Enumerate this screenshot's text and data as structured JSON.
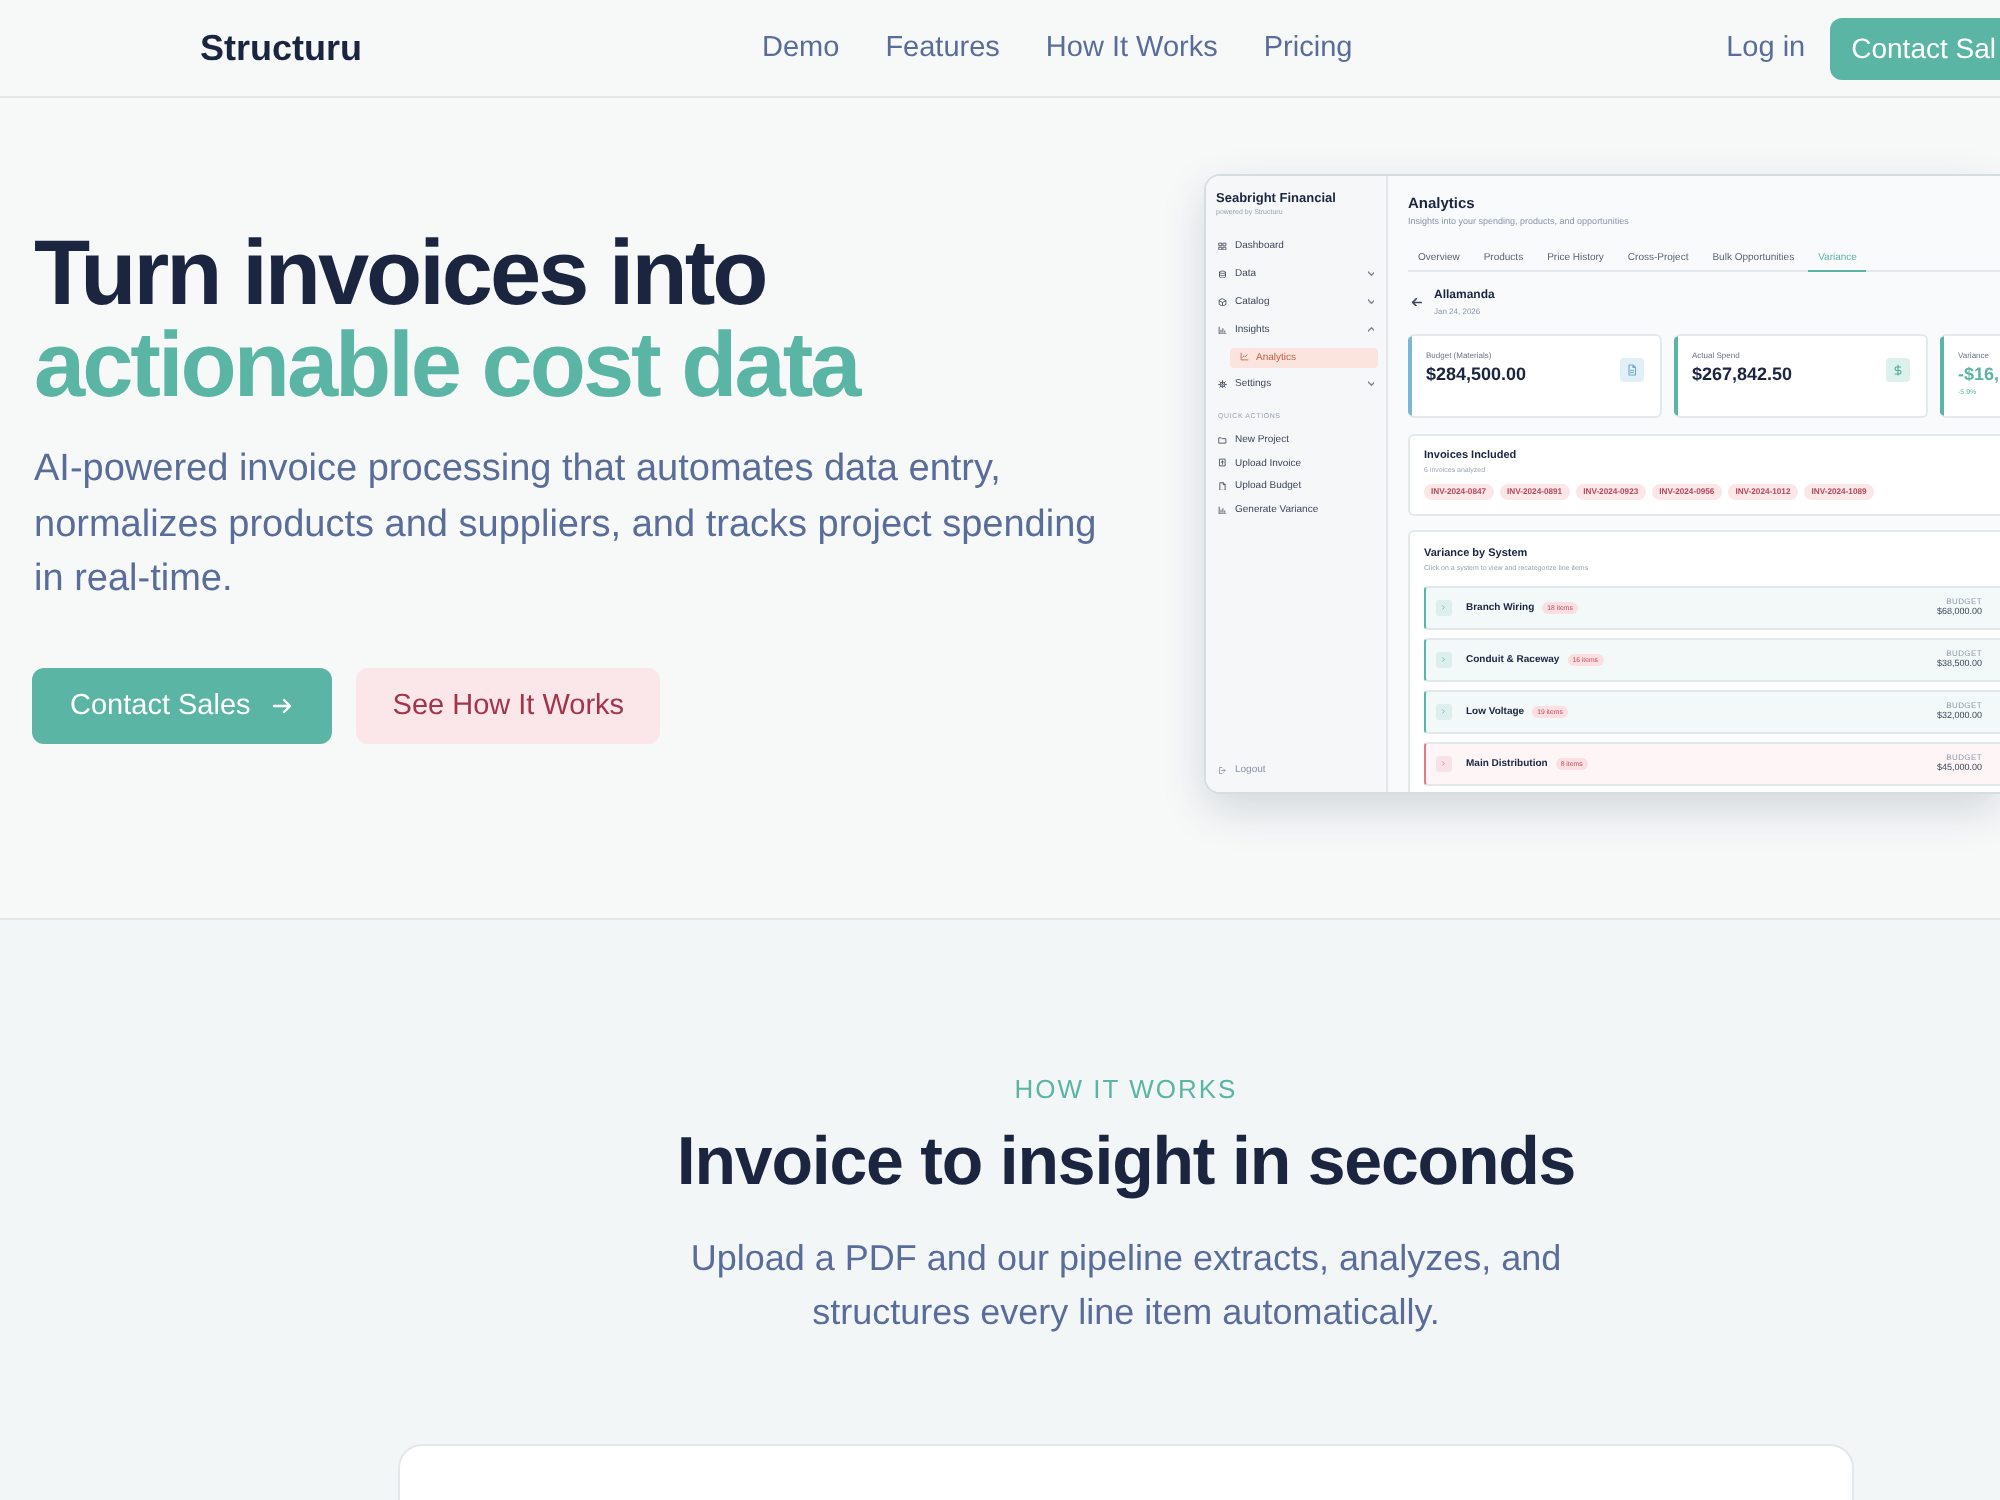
{
  "nav": {
    "logo": "Structuru",
    "links": [
      {
        "label": "Demo"
      },
      {
        "label": "Features"
      },
      {
        "label": "How It Works"
      },
      {
        "label": "Pricing"
      }
    ],
    "login": "Log in",
    "cta": "Contact Sal"
  },
  "hero": {
    "title": [
      {
        "text": "Turn invoices into",
        "kind": "plain"
      },
      {
        "text": "actionable cost data",
        "kind": "accent"
      }
    ],
    "description": "AI-powered invoice processing that automates data entry, normalizes products and suppliers, and tracks project spending in real-time.",
    "buttons": [
      {
        "label": "Contact Sales",
        "kind": "primary"
      },
      {
        "label": "See How It Works",
        "kind": "secondary"
      }
    ]
  },
  "app_preview": {
    "sidebar": {
      "org": "Seabright Financial",
      "tagline": "powered by Structuru",
      "items": [
        {
          "label": "Dashboard",
          "kind": "link",
          "selected": false
        },
        {
          "label": "Data",
          "kind": "group",
          "expanded": false,
          "selected": false
        },
        {
          "label": "Catalog",
          "kind": "group",
          "expanded": false,
          "selected": false
        },
        {
          "label": "Insights",
          "kind": "group",
          "expanded": true,
          "selected": false,
          "children": [
            {
              "label": "Analytics",
              "selected": true
            }
          ]
        },
        {
          "label": "Settings",
          "kind": "group",
          "expanded": false,
          "selected": false
        }
      ],
      "quick_actions_title": "QUICK ACTIONS",
      "quick_actions": [
        {
          "label": "New Project"
        },
        {
          "label": "Upload Invoice"
        },
        {
          "label": "Upload Budget"
        },
        {
          "label": "Generate Variance"
        }
      ],
      "logout": "Logout"
    },
    "page": {
      "title": "Analytics",
      "subtitle": "Insights into your spending, products, and opportunities",
      "tabs": [
        {
          "label": "Overview",
          "selected": false
        },
        {
          "label": "Products",
          "selected": false
        },
        {
          "label": "Price History",
          "selected": false
        },
        {
          "label": "Cross-Project",
          "selected": false
        },
        {
          "label": "Bulk Opportunities",
          "selected": false
        },
        {
          "label": "Variance",
          "selected": true
        }
      ],
      "project": {
        "name": "Allamanda",
        "date": "Jan 24, 2026"
      },
      "stat_cards": [
        {
          "kind": "budget",
          "label": "Budget (Materials)",
          "value": "$284,500.00",
          "color": "#7ab8d8"
        },
        {
          "kind": "spend",
          "label": "Actual Spend",
          "value": "$267,842.50",
          "color": "#5bb5a5"
        },
        {
          "kind": "variance",
          "label": "Variance",
          "value": "-$16,",
          "change": "-5.9%",
          "color": "#5bb5a5"
        }
      ],
      "invoices": {
        "title": "Invoices Included",
        "subtitle": "6 invoices analyzed",
        "chips": [
          "INV-2024-0847",
          "INV-2024-0891",
          "INV-2024-0923",
          "INV-2024-0956",
          "INV-2024-1012",
          "INV-2024-1089"
        ]
      },
      "variance": {
        "title": "Variance by System",
        "subtitle": "Click on a system to view and recategorize line items",
        "rows": [
          {
            "name": "Branch Wiring",
            "count": "18 items",
            "budget_label": "BUDGET",
            "budget": "$68,000.00",
            "color": "#5bb5a5"
          },
          {
            "name": "Conduit & Raceway",
            "count": "16 items",
            "budget_label": "BUDGET",
            "budget": "$38,500.00",
            "color": "#5bb5a5"
          },
          {
            "name": "Low Voltage",
            "count": "19 items",
            "budget_label": "BUDGET",
            "budget": "$32,000.00",
            "color": "#5bb5a5"
          },
          {
            "name": "Main Distribution",
            "count": "8 items",
            "budget_label": "BUDGET",
            "budget": "$45,000.00",
            "color": "#e07a86"
          }
        ]
      }
    }
  },
  "how_it_works": {
    "eyebrow": "HOW IT WORKS",
    "heading": "Invoice to insight in seconds",
    "description": "Upload a PDF and our pipeline extracts, analyzes, and structures every line item automatically."
  }
}
